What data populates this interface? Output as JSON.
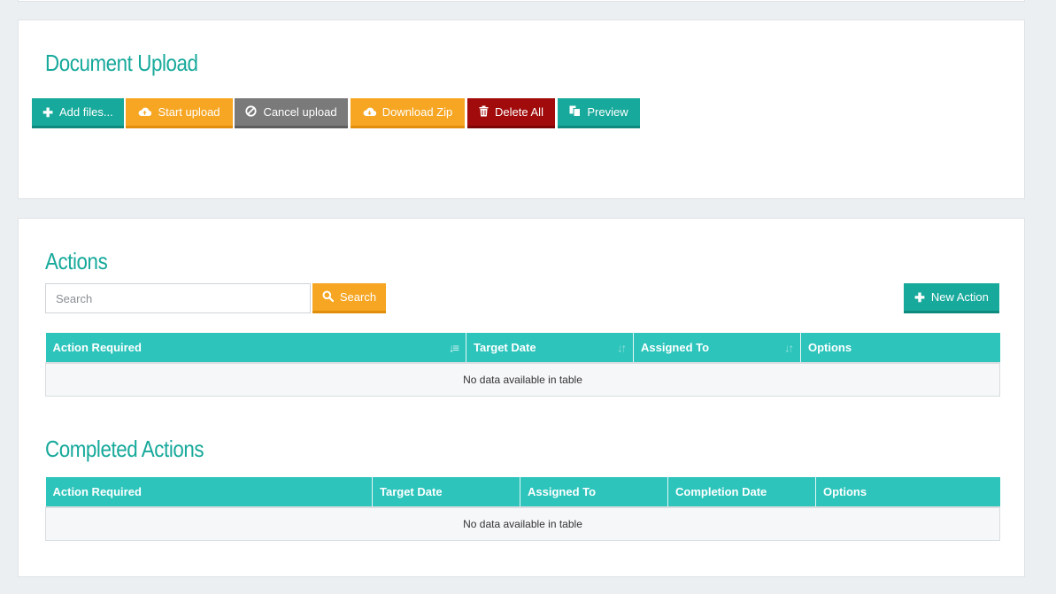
{
  "upload": {
    "title": "Document Upload",
    "buttons": {
      "add_files": "Add files...",
      "start_upload": "Start upload",
      "cancel_upload": "Cancel upload",
      "download_zip": "Download Zip",
      "delete_all": "Delete All",
      "preview": "Preview"
    },
    "icons": {
      "add_files": "plus-icon",
      "start_upload": "cloud-upload-icon",
      "cancel_upload": "ban-icon",
      "download_zip": "cloud-download-icon",
      "delete_all": "trash-icon",
      "preview": "copy-icon"
    }
  },
  "actions": {
    "title": "Actions",
    "search_placeholder": "Search",
    "search_button": "Search",
    "new_action_button": "New Action",
    "columns": [
      "Action Required",
      "Target Date",
      "Assigned To",
      "Options"
    ],
    "empty_text": "No data available in table"
  },
  "completed": {
    "title": "Completed Actions",
    "columns": [
      "Action Required",
      "Target Date",
      "Assigned To",
      "Completion Date",
      "Options"
    ],
    "empty_text": "No data available in table"
  },
  "colors": {
    "accent_teal": "#17a99b",
    "table_header": "#2cc4bb",
    "orange": "#f6a623",
    "gray": "#7a7a7a",
    "danger": "#a10b0b",
    "background": "#ebeff2"
  }
}
